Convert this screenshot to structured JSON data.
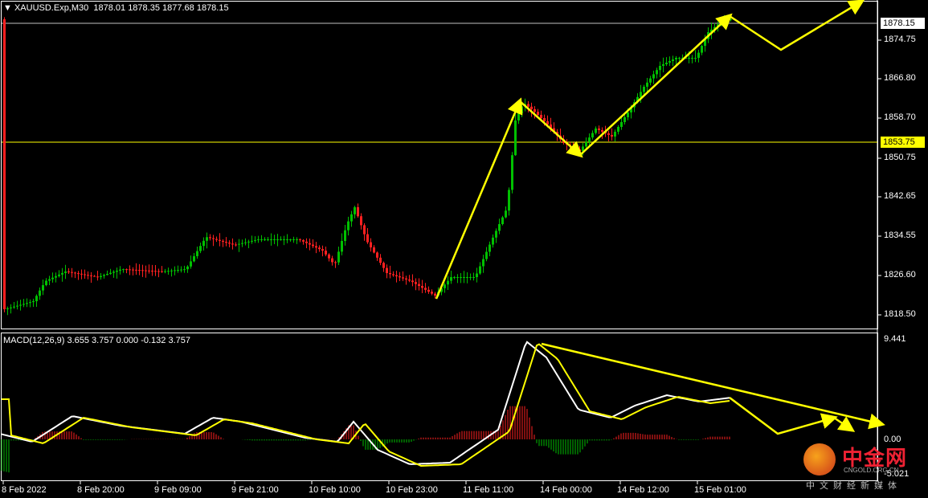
{
  "header": {
    "symbol_line": "XAUUSD.Exp,M30  1878.01 1878.35 1877.68 1878.15",
    "macd_line": "MACD(12,26,9) 3.655 3.757 0.000 -0.132 3.757"
  },
  "price_axis": {
    "labels": [
      "1874.75",
      "1866.80",
      "1858.70",
      "1850.75",
      "1842.65",
      "1834.55",
      "1826.60",
      "1818.50"
    ],
    "current_price_tag": "1878.15",
    "hline_tag": "1853.75"
  },
  "macd_axis": {
    "labels": [
      "9.441",
      "0.00",
      "-5.021"
    ]
  },
  "time_axis": {
    "labels": [
      "8 Feb 2022",
      "8 Feb 20:00",
      "9 Feb 09:00",
      "9 Feb 21:00",
      "10 Feb 10:00",
      "10 Feb 23:00",
      "11 Feb 11:00",
      "14 Feb 00:00",
      "14 Feb 12:00",
      "15 Feb 01:00"
    ]
  },
  "watermark": {
    "cn": "中金网",
    "en": "CNGOLD.ORG.CN",
    "sub": "中文财经新媒体"
  },
  "colors": {
    "bull": "#00c000",
    "bear": "#ff2020",
    "arrow": "#ffff00",
    "macd_main": "#ffffff",
    "macd_signal": "#ffff00"
  }
}
